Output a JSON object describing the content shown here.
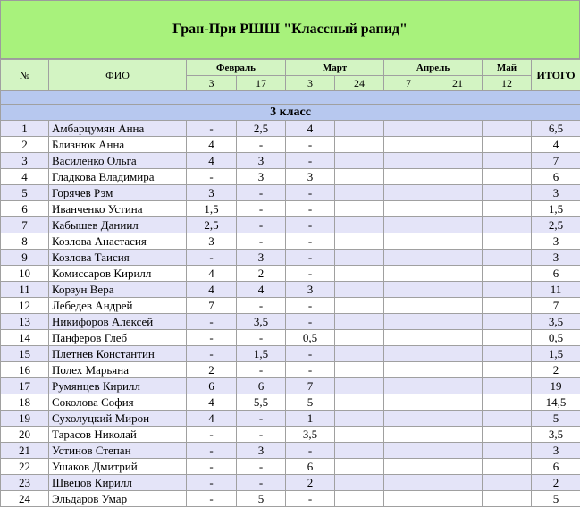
{
  "title": "Гран-При РШШ \"Классный рапид\"",
  "header": {
    "num": "№",
    "fio": "ФИО",
    "total": "ИТОГО",
    "months": [
      {
        "label": "Февраль",
        "span": 2
      },
      {
        "label": "Март",
        "span": 2
      },
      {
        "label": "Апрель",
        "span": 2
      },
      {
        "label": "Май",
        "span": 1
      }
    ],
    "days": [
      "3",
      "17",
      "3",
      "24",
      "7",
      "21",
      "12"
    ]
  },
  "section_label": "3 класс",
  "rows": [
    {
      "num": "1",
      "name": "Амбарцумян Анна",
      "scores": [
        "-",
        "2,5",
        "4",
        "",
        "",
        "",
        ""
      ],
      "total": "6,5"
    },
    {
      "num": "2",
      "name": "Близнюк Анна",
      "scores": [
        "4",
        "-",
        "-",
        "",
        "",
        "",
        ""
      ],
      "total": "4"
    },
    {
      "num": "3",
      "name": "Василенко Ольга",
      "scores": [
        "4",
        "3",
        "-",
        "",
        "",
        "",
        ""
      ],
      "total": "7"
    },
    {
      "num": "4",
      "name": "Гладкова Владимира",
      "scores": [
        "-",
        "3",
        "3",
        "",
        "",
        "",
        ""
      ],
      "total": "6"
    },
    {
      "num": "5",
      "name": "Горячев Рэм",
      "scores": [
        "3",
        "-",
        "-",
        "",
        "",
        "",
        ""
      ],
      "total": "3"
    },
    {
      "num": "6",
      "name": "Иванченко Устина",
      "scores": [
        "1,5",
        "-",
        "-",
        "",
        "",
        "",
        ""
      ],
      "total": "1,5"
    },
    {
      "num": "7",
      "name": "Кабышев Даниил",
      "scores": [
        "2,5",
        "-",
        "-",
        "",
        "",
        "",
        ""
      ],
      "total": "2,5"
    },
    {
      "num": "8",
      "name": "Козлова Анастасия",
      "scores": [
        "3",
        "-",
        "-",
        "",
        "",
        "",
        ""
      ],
      "total": "3"
    },
    {
      "num": "9",
      "name": "Козлова Таисия",
      "scores": [
        "-",
        "3",
        "-",
        "",
        "",
        "",
        ""
      ],
      "total": "3"
    },
    {
      "num": "10",
      "name": "Комиссаров Кирилл",
      "scores": [
        "4",
        "2",
        "-",
        "",
        "",
        "",
        ""
      ],
      "total": "6"
    },
    {
      "num": "11",
      "name": "Корзун Вера",
      "scores": [
        "4",
        "4",
        "3",
        "",
        "",
        "",
        ""
      ],
      "total": "11"
    },
    {
      "num": "12",
      "name": "Лебедев Андрей",
      "scores": [
        "7",
        "-",
        "-",
        "",
        "",
        "",
        ""
      ],
      "total": "7"
    },
    {
      "num": "13",
      "name": "Никифоров Алексей",
      "scores": [
        "-",
        "3,5",
        "-",
        "",
        "",
        "",
        ""
      ],
      "total": "3,5"
    },
    {
      "num": "14",
      "name": "Панферов Глеб",
      "scores": [
        "-",
        "-",
        "0,5",
        "",
        "",
        "",
        ""
      ],
      "total": "0,5"
    },
    {
      "num": "15",
      "name": "Плетнев Константин",
      "scores": [
        "-",
        "1,5",
        "-",
        "",
        "",
        "",
        ""
      ],
      "total": "1,5"
    },
    {
      "num": "16",
      "name": "Полех Марьяна",
      "scores": [
        "2",
        "-",
        "-",
        "",
        "",
        "",
        ""
      ],
      "total": "2"
    },
    {
      "num": "17",
      "name": "Румянцев Кирилл",
      "scores": [
        "6",
        "6",
        "7",
        "",
        "",
        "",
        ""
      ],
      "total": "19"
    },
    {
      "num": "18",
      "name": "Соколова София",
      "scores": [
        "4",
        "5,5",
        "5",
        "",
        "",
        "",
        ""
      ],
      "total": "14,5"
    },
    {
      "num": "19",
      "name": "Сухолуцкий Мирон",
      "scores": [
        "4",
        "-",
        "1",
        "",
        "",
        "",
        ""
      ],
      "total": "5"
    },
    {
      "num": "20",
      "name": "Тарасов Николай",
      "scores": [
        "-",
        "-",
        "3,5",
        "",
        "",
        "",
        ""
      ],
      "total": "3,5"
    },
    {
      "num": "21",
      "name": "Устинов Степан",
      "scores": [
        "-",
        "3",
        "-",
        "",
        "",
        "",
        ""
      ],
      "total": "3"
    },
    {
      "num": "22",
      "name": "Ушаков Дмитрий",
      "scores": [
        "-",
        "-",
        "6",
        "",
        "",
        "",
        ""
      ],
      "total": "6"
    },
    {
      "num": "23",
      "name": "Швецов Кирилл",
      "scores": [
        "-",
        "-",
        "2",
        "",
        "",
        "",
        ""
      ],
      "total": "2"
    },
    {
      "num": "24",
      "name": "Эльдаров Умар",
      "scores": [
        "-",
        "5",
        "-",
        "",
        "",
        "",
        ""
      ],
      "total": "5"
    }
  ]
}
